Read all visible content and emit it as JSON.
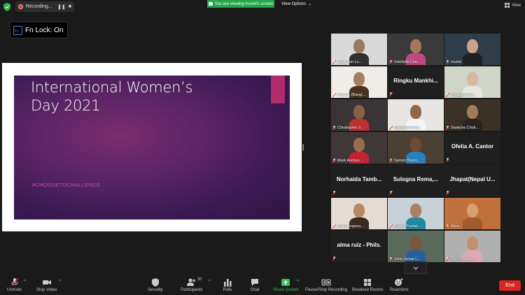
{
  "topbar": {
    "recording_label": "Recording...",
    "pause_icon": "pause-icon",
    "stop_icon": "stop-icon",
    "viewing_banner": "You are viewing muriel's screen",
    "view_options": "View Options",
    "view_label": "View"
  },
  "fn_lock": {
    "label": "Fn Lock: On",
    "key": "Fn"
  },
  "slide": {
    "title_line1": "International Women’s",
    "title_line2": "Day 2021",
    "subtitle": "#CHOOSETOCHALLENGE"
  },
  "gallery": {
    "tiles": [
      {
        "name": "Sayk Tun Lu...",
        "type": "video"
      },
      {
        "name": "Interfaith Coo...",
        "type": "video"
      },
      {
        "name": "muriel",
        "type": "video",
        "active": true
      },
      {
        "name": "Psyche (Bangl...",
        "type": "video"
      },
      {
        "name": "Ringku Mankhi...",
        "type": "name"
      },
      {
        "name": "Annika Denk...",
        "type": "video"
      },
      {
        "name": "Christopher J...",
        "type": "video"
      },
      {
        "name": "Shyamal Paroi",
        "type": "video"
      },
      {
        "name": "Swatcha Choil...",
        "type": "video"
      },
      {
        "name": "Mark Anckon ...",
        "type": "video"
      },
      {
        "name": "Symon Bepro...",
        "type": "video"
      },
      {
        "name": "Ofelia A. Cantor",
        "type": "name"
      },
      {
        "name": "Norhaida Tamb...",
        "type": "name"
      },
      {
        "name": "Sulogna Rema,...",
        "type": "name"
      },
      {
        "name": "Jhapat(Nepal U...",
        "type": "name"
      },
      {
        "name": "Klein Empera...",
        "type": "video"
      },
      {
        "name": "Kenaz Pantak...",
        "type": "video"
      },
      {
        "name": "Aliza",
        "type": "video"
      },
      {
        "name": "alma ruiz - Phils.",
        "type": "name"
      },
      {
        "name": "John Jomar L...",
        "type": "video"
      },
      {
        "name": "Dory-Philippi...",
        "type": "video"
      }
    ]
  },
  "toolbar": {
    "unmute": "Unmute",
    "stop_video": "Stop Video",
    "security": "Security",
    "participants": "Participants",
    "participants_count": "30",
    "polls": "Polls",
    "chat": "Chat",
    "share_screen": "Share Screen",
    "record": "Pause/Stop Recording",
    "breakout": "Breakout Rooms",
    "reactions": "Reactions",
    "end": "End"
  },
  "colors": {
    "share_green": "#3ec35a",
    "end_red": "#d9261f",
    "active_speaker": "#dddd4a",
    "slide_accent": "#b22b6c"
  }
}
